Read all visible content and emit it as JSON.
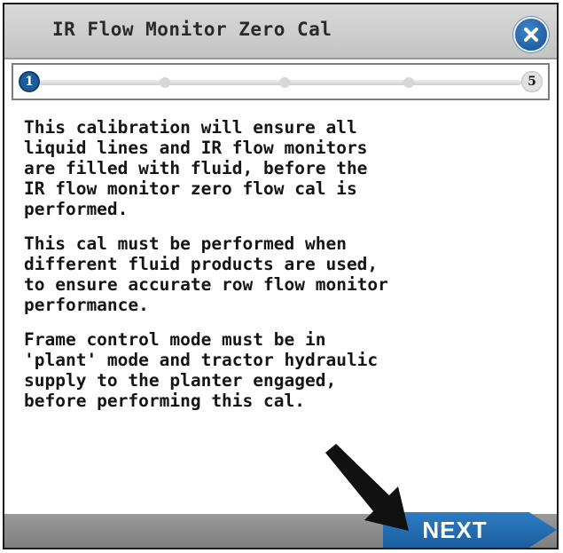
{
  "window": {
    "title": "IR Flow Monitor Zero Cal",
    "close_icon": "close-icon"
  },
  "progress": {
    "current_step": "1",
    "total_steps": "5"
  },
  "content": {
    "paragraphs": [
      "This calibration will ensure all\nliquid lines and IR flow monitors\nare filled with fluid, before the\nIR flow monitor zero flow cal is\nperformed.",
      "This cal must be performed when\ndifferent fluid products are used,\nto ensure accurate row flow monitor\nperformance.",
      "Frame control mode must be in\n'plant' mode and tractor hydraulic\nsupply to the planter engaged,\nbefore performing this cal."
    ]
  },
  "footer": {
    "next_label": "NEXT"
  },
  "colors": {
    "accent": "#1b5e9f",
    "titlebar": "#cfcfcf",
    "footer": "#8c8c8c"
  }
}
